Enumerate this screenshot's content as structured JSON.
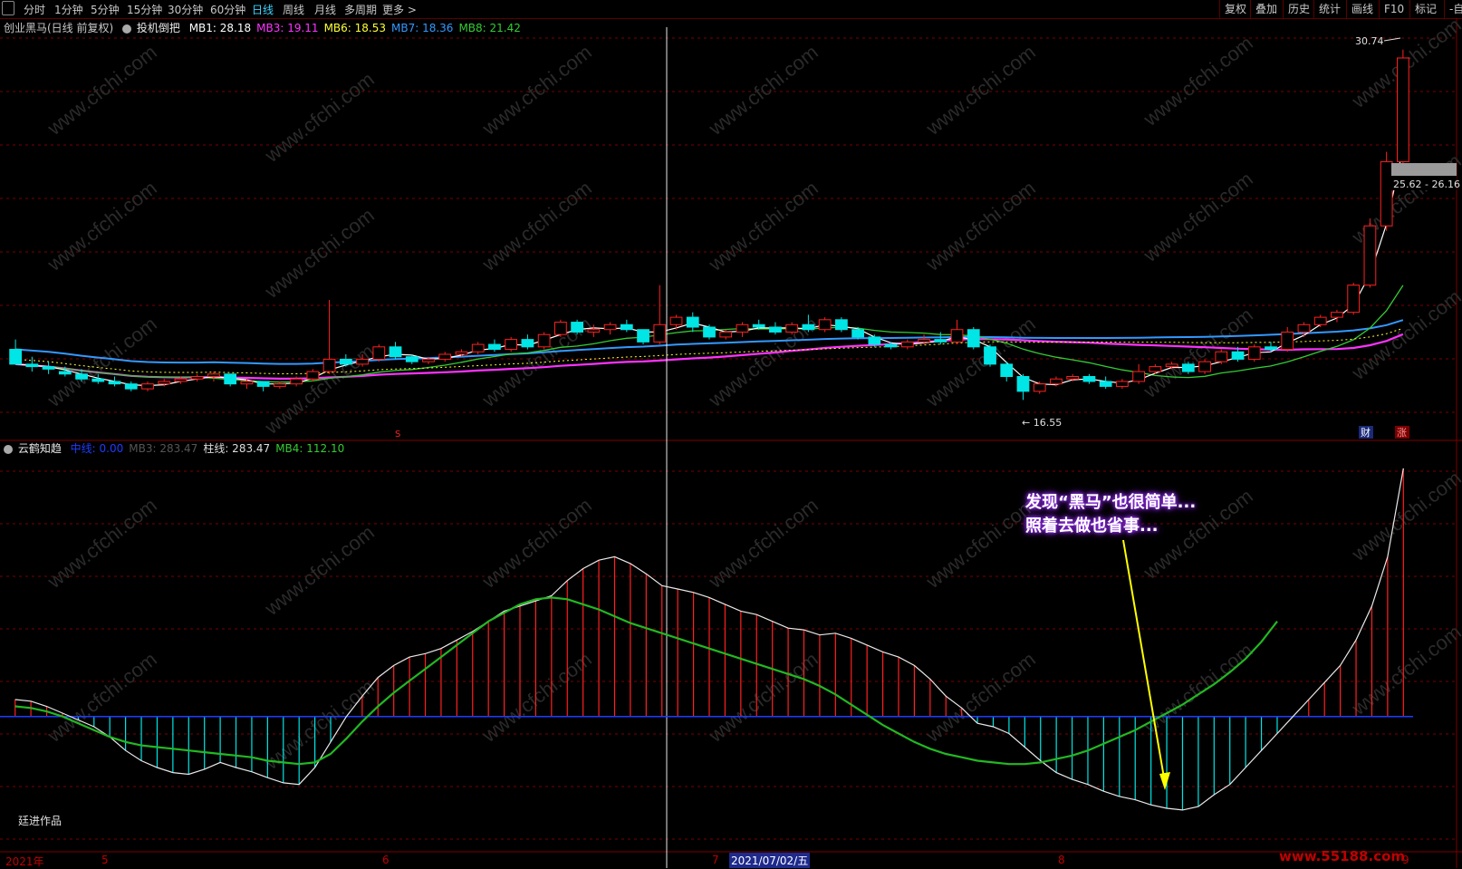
{
  "toolbar": {
    "left_items": [
      "分时",
      "1分钟",
      "5分钟",
      "15分钟",
      "30分钟",
      "60分钟",
      "日线",
      "周线",
      "月线",
      "多周期",
      "更多 >"
    ],
    "active_index": 6,
    "right_items": [
      "复权",
      "叠加",
      "历史",
      "统计",
      "画线",
      "F10",
      "标记",
      "-自选"
    ]
  },
  "main_panel": {
    "title": "创业黑马(日线 前复权)",
    "indicator_name": "投机倒把",
    "mas": [
      {
        "label": "MB1: 28.18",
        "color": "#ffffff"
      },
      {
        "label": "MB3: 19.11",
        "color": "#ff33ff"
      },
      {
        "label": "MB6: 18.53",
        "color": "#ffff33"
      },
      {
        "label": "MB7: 18.36",
        "color": "#3399ff"
      },
      {
        "label": "MB8: 21.42",
        "color": "#33cc33"
      }
    ],
    "high_label": "30.74",
    "low_label": "16.55",
    "price_box": "25.62 - 26.16",
    "marker_s": "S",
    "marker_cai": "财",
    "marker_zhang": "涨"
  },
  "sub_panel": {
    "title": "云鹤知趋",
    "items": [
      {
        "label": "中线: 0.00",
        "color": "#1e3cff"
      },
      {
        "label": "MB3: 283.47",
        "color": "#555555"
      },
      {
        "label": "柱线: 283.47",
        "color": "#dddddd"
      },
      {
        "label": "MB4: 112.10",
        "color": "#33cc33"
      }
    ]
  },
  "callout": {
    "line1": "发现“黑马”也很简单...",
    "line2": "照着去做也省事..."
  },
  "author": "廷进作品",
  "x_axis": {
    "labels": [
      "2021年",
      "5",
      "6",
      "7",
      "8",
      "9"
    ],
    "cursor_date": "2021/07/02/五"
  },
  "watermark": {
    "text": "www.cfchi.com",
    "corner": "www.55188.com"
  },
  "colors": {
    "up": "#ff2020",
    "down": "#00e5e5",
    "ma_short": "#ffffff",
    "ma_mid": "#33cc33",
    "ma_long": "#ff33ff",
    "ma_blue": "#3399ff",
    "grid": "#7a0000",
    "zero_line": "#1e3cff"
  },
  "chart_data": {
    "type": "candlestick",
    "ohlc": [
      [
        18.6,
        19.0,
        18.0,
        18.0
      ],
      [
        18.0,
        18.3,
        17.7,
        17.9
      ],
      [
        17.9,
        18.1,
        17.6,
        17.8
      ],
      [
        17.7,
        17.9,
        17.5,
        17.6
      ],
      [
        17.6,
        17.8,
        17.3,
        17.4
      ],
      [
        17.4,
        17.6,
        17.2,
        17.3
      ],
      [
        17.3,
        17.5,
        17.1,
        17.2
      ],
      [
        17.2,
        17.3,
        16.9,
        17.0
      ],
      [
        17.0,
        17.3,
        16.9,
        17.2
      ],
      [
        17.2,
        17.4,
        17.1,
        17.3
      ],
      [
        17.3,
        17.5,
        17.2,
        17.4
      ],
      [
        17.4,
        17.6,
        17.3,
        17.5
      ],
      [
        17.5,
        17.7,
        17.3,
        17.6
      ],
      [
        17.6,
        17.5,
        17.1,
        17.2
      ],
      [
        17.2,
        17.4,
        17.0,
        17.3
      ],
      [
        17.3,
        17.3,
        16.9,
        17.1
      ],
      [
        17.1,
        17.3,
        17.0,
        17.2
      ],
      [
        17.2,
        17.5,
        17.1,
        17.4
      ],
      [
        17.4,
        17.8,
        17.3,
        17.7
      ],
      [
        17.7,
        20.6,
        17.6,
        18.2
      ],
      [
        18.2,
        18.4,
        17.9,
        18.0
      ],
      [
        18.0,
        18.4,
        17.9,
        18.2
      ],
      [
        18.2,
        18.8,
        18.1,
        18.7
      ],
      [
        18.7,
        18.9,
        18.2,
        18.3
      ],
      [
        18.3,
        18.4,
        18.0,
        18.1
      ],
      [
        18.1,
        18.3,
        18.0,
        18.2
      ],
      [
        18.2,
        18.5,
        18.1,
        18.4
      ],
      [
        18.4,
        18.6,
        18.3,
        18.5
      ],
      [
        18.5,
        18.9,
        18.4,
        18.8
      ],
      [
        18.8,
        19.0,
        18.5,
        18.6
      ],
      [
        18.6,
        19.1,
        18.5,
        19.0
      ],
      [
        19.0,
        19.2,
        18.6,
        18.7
      ],
      [
        18.7,
        19.3,
        18.6,
        19.2
      ],
      [
        19.2,
        19.8,
        19.1,
        19.7
      ],
      [
        19.7,
        19.8,
        19.2,
        19.3
      ],
      [
        19.3,
        19.6,
        19.1,
        19.4
      ],
      [
        19.4,
        19.7,
        19.2,
        19.6
      ],
      [
        19.6,
        19.8,
        19.3,
        19.4
      ],
      [
        19.4,
        19.2,
        18.8,
        18.9
      ],
      [
        18.9,
        21.2,
        18.8,
        19.6
      ],
      [
        19.6,
        20.0,
        19.4,
        19.9
      ],
      [
        19.9,
        20.1,
        19.3,
        19.5
      ],
      [
        19.5,
        19.6,
        19.0,
        19.1
      ],
      [
        19.1,
        19.4,
        19.0,
        19.3
      ],
      [
        19.3,
        19.7,
        19.1,
        19.6
      ],
      [
        19.6,
        19.8,
        19.4,
        19.5
      ],
      [
        19.5,
        19.7,
        19.2,
        19.3
      ],
      [
        19.3,
        19.7,
        19.2,
        19.6
      ],
      [
        19.6,
        20.0,
        19.3,
        19.4
      ],
      [
        19.4,
        19.9,
        19.3,
        19.8
      ],
      [
        19.8,
        19.9,
        19.3,
        19.4
      ],
      [
        19.4,
        19.5,
        19.0,
        19.1
      ],
      [
        19.1,
        19.2,
        18.7,
        18.8
      ],
      [
        18.8,
        18.9,
        18.6,
        18.7
      ],
      [
        18.7,
        19.0,
        18.6,
        18.9
      ],
      [
        18.9,
        19.2,
        18.8,
        19.0
      ],
      [
        19.0,
        19.3,
        18.8,
        18.9
      ],
      [
        18.9,
        19.8,
        18.8,
        19.4
      ],
      [
        19.4,
        19.5,
        18.6,
        18.7
      ],
      [
        18.7,
        18.8,
        17.9,
        18.0
      ],
      [
        18.0,
        18.1,
        17.3,
        17.5
      ],
      [
        17.5,
        17.6,
        16.55,
        16.9
      ],
      [
        16.9,
        17.3,
        16.8,
        17.2
      ],
      [
        17.2,
        17.5,
        17.1,
        17.4
      ],
      [
        17.4,
        17.6,
        17.3,
        17.5
      ],
      [
        17.5,
        17.6,
        17.2,
        17.3
      ],
      [
        17.3,
        17.5,
        17.0,
        17.1
      ],
      [
        17.1,
        17.4,
        17.0,
        17.3
      ],
      [
        17.3,
        18.0,
        17.2,
        17.7
      ],
      [
        17.7,
        18.0,
        17.6,
        17.9
      ],
      [
        17.9,
        18.1,
        17.8,
        18.0
      ],
      [
        18.0,
        18.1,
        17.6,
        17.7
      ],
      [
        17.7,
        18.2,
        17.6,
        18.1
      ],
      [
        18.1,
        18.6,
        18.0,
        18.5
      ],
      [
        18.5,
        18.7,
        18.1,
        18.2
      ],
      [
        18.2,
        18.8,
        18.1,
        18.7
      ],
      [
        18.7,
        18.9,
        18.5,
        18.6
      ],
      [
        18.6,
        19.5,
        18.5,
        19.3
      ],
      [
        19.3,
        19.7,
        19.1,
        19.6
      ],
      [
        19.6,
        20.0,
        19.5,
        19.9
      ],
      [
        19.9,
        20.2,
        19.7,
        20.1
      ],
      [
        20.1,
        21.3,
        20.0,
        21.2
      ],
      [
        21.2,
        23.9,
        21.1,
        23.6
      ],
      [
        23.6,
        26.6,
        23.4,
        26.2
      ],
      [
        26.2,
        30.74,
        26.0,
        30.4
      ]
    ],
    "ylim": [
      15.5,
      31.5
    ],
    "mas": {
      "MB1": {
        "color": "#ffffff"
      },
      "MB3": {
        "color": "#ff33ff"
      },
      "MB7": {
        "color": "#3399ff"
      },
      "MB8": {
        "color": "#33cc33"
      }
    },
    "oscillator": {
      "values": [
        20,
        18,
        12,
        4,
        -4,
        -12,
        -24,
        -40,
        -52,
        -60,
        -66,
        -68,
        -62,
        -54,
        -60,
        -65,
        -72,
        -78,
        -80,
        -60,
        -30,
        0,
        24,
        46,
        60,
        70,
        74,
        80,
        90,
        100,
        112,
        124,
        130,
        136,
        142,
        160,
        174,
        184,
        188,
        180,
        168,
        154,
        150,
        146,
        140,
        132,
        124,
        120,
        112,
        104,
        102,
        96,
        98,
        92,
        84,
        76,
        70,
        60,
        44,
        24,
        10,
        -8,
        -12,
        -20,
        -36,
        -52,
        -66,
        -74,
        -80,
        -88,
        -94,
        -98,
        -104,
        -108,
        -110,
        -106,
        -92,
        -80,
        -60,
        -40,
        -20,
        0,
        20,
        40,
        60,
        90,
        130,
        188,
        292
      ],
      "signal": [
        12,
        10,
        6,
        0,
        -8,
        -16,
        -24,
        -30,
        -34,
        -36,
        -38,
        -40,
        -42,
        -44,
        -46,
        -48,
        -52,
        -54,
        -56,
        -54,
        -44,
        -26,
        -6,
        12,
        28,
        42,
        56,
        70,
        84,
        98,
        112,
        122,
        132,
        138,
        140,
        138,
        132,
        126,
        118,
        110,
        104,
        98,
        92,
        86,
        80,
        74,
        68,
        62,
        56,
        50,
        44,
        36,
        26,
        14,
        2,
        -10,
        -20,
        -30,
        -38,
        -44,
        -48,
        -52,
        -54,
        -56,
        -56,
        -54,
        -50,
        -46,
        -40,
        -32,
        -24,
        -16,
        -6,
        4,
        14,
        26,
        38,
        52,
        68,
        88,
        112
      ],
      "ylim": [
        -140,
        310
      ],
      "zero": 0
    }
  }
}
